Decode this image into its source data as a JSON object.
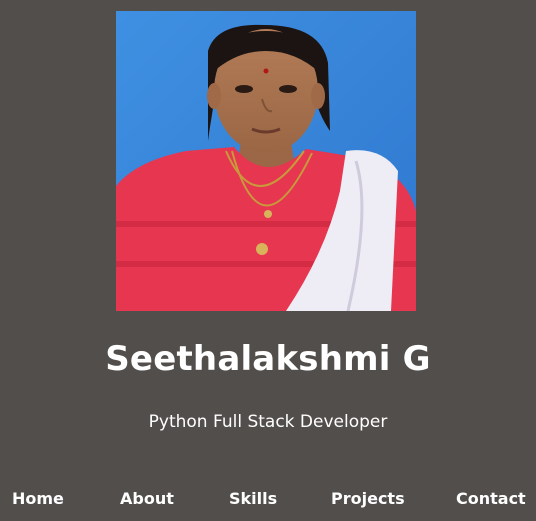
{
  "profile": {
    "name": "Seethalakshmi G",
    "role": "Python Full Stack Developer",
    "photo_icon": "profile-photo"
  },
  "nav": {
    "items": [
      {
        "label": "Home"
      },
      {
        "label": "About"
      },
      {
        "label": "Skills"
      },
      {
        "label": "Projects"
      },
      {
        "label": "Contact"
      }
    ]
  },
  "colors": {
    "background": "#524e4c",
    "text": "#ffffff",
    "photo_background": "#3d8ee0"
  }
}
